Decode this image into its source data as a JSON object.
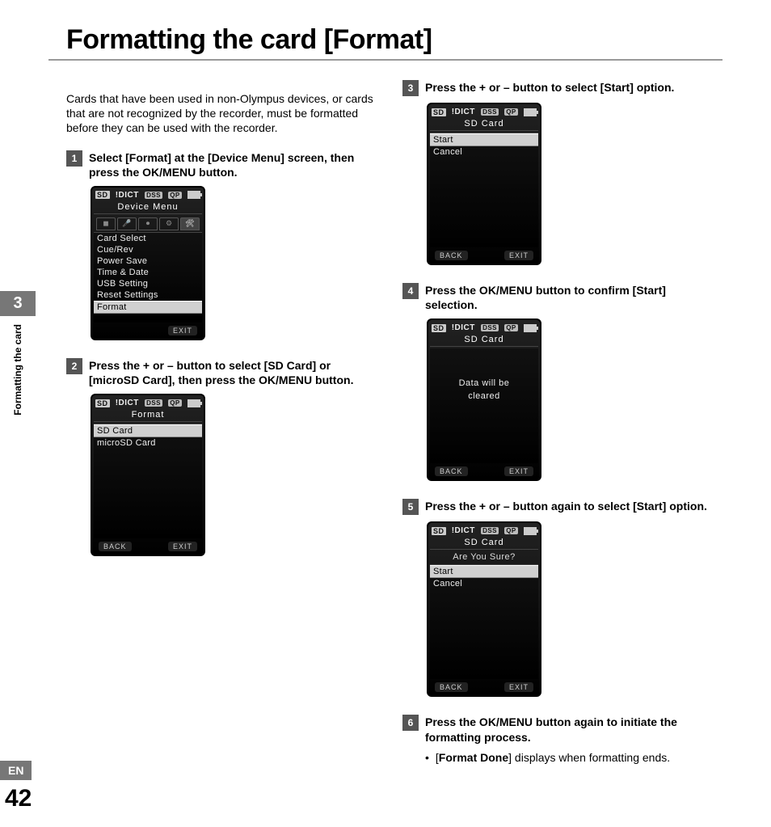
{
  "page_title": "Formatting the card [Format]",
  "intro": "Cards that have been used in non-Olympus devices, or cards that are not recognized by the recorder, must be formatted before they can be used with the recorder.",
  "side": {
    "chapter_number": "3",
    "chapter_label": "Formatting the card"
  },
  "footer": {
    "lang": "EN",
    "page": "42"
  },
  "status_bar": {
    "sd": "SD",
    "dict": "DICT",
    "dss": "DSS",
    "qp": "QP"
  },
  "steps": [
    {
      "num": "1",
      "text": "Select [Format] at the [Device Menu] screen, then press the OK/MENU button.",
      "screen": {
        "title": "Device Menu",
        "tabs": [
          "◼",
          "🎤",
          "⏺",
          "⚙",
          "🛠"
        ],
        "active_tab": 4,
        "items": [
          "Card Select",
          "Cue/Rev",
          "Power Save",
          "Time & Date",
          "USB Setting",
          "Reset Settings",
          "Format"
        ],
        "selected_index": 6,
        "softkeys": {
          "left": "",
          "right": "EXIT"
        }
      }
    },
    {
      "num": "2",
      "text": "Press the + or – button to select [SD Card] or [microSD Card], then press the OK/MENU button.",
      "screen": {
        "title": "Format",
        "items": [
          "SD Card",
          "microSD Card"
        ],
        "selected_index": 0,
        "tall": true,
        "softkeys": {
          "left": "BACK",
          "right": "EXIT"
        }
      }
    },
    {
      "num": "3",
      "text": "Press the + or – button to select [Start] option.",
      "screen": {
        "title": "SD Card",
        "items": [
          "Start",
          "Cancel"
        ],
        "selected_index": 0,
        "tall": true,
        "softkeys": {
          "left": "BACK",
          "right": "EXIT"
        }
      }
    },
    {
      "num": "4",
      "text": "Press the OK/MENU button to confirm [Start] selection.",
      "screen": {
        "title": "SD Card",
        "message": "Data will be\ncleared",
        "tall": true,
        "softkeys": {
          "left": "BACK",
          "right": "EXIT"
        }
      }
    },
    {
      "num": "5",
      "text": "Press the + or – button again to select [Start] option.",
      "screen": {
        "title": "SD Card",
        "subtext": "Are You Sure?",
        "items": [
          "Start",
          "Cancel"
        ],
        "selected_index": 0,
        "tall": true,
        "softkeys": {
          "left": "BACK",
          "right": "EXIT"
        }
      }
    },
    {
      "num": "6",
      "text": "Press the OK/MENU button again to initiate the formatting process.",
      "bullets": [
        {
          "pre": "[",
          "bold": "Format Done",
          "post": "] displays when formatting ends."
        }
      ]
    }
  ]
}
